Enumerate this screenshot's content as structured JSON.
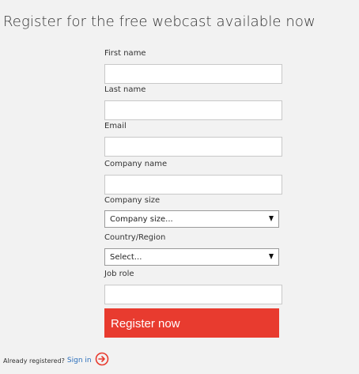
{
  "page": {
    "title": "Register for the free webcast available now"
  },
  "form": {
    "first_name_label": "First name",
    "first_name_value": "",
    "last_name_label": "Last name",
    "last_name_value": "",
    "email_label": "Email",
    "email_value": "",
    "company_name_label": "Company name",
    "company_name_value": "",
    "company_size_label": "Company size",
    "company_size_selected": "Company size...",
    "country_label": "Country/Region",
    "country_selected": "Select...",
    "job_role_label": "Job role",
    "job_role_value": "",
    "register_label": "Register now"
  },
  "footer": {
    "already_registered_text": "Already registered?",
    "sign_in_label": "Sign in",
    "arrow_icon": "circle-arrow-right-icon"
  },
  "colors": {
    "background": "#f2f2f2",
    "accent": "#e83b2f",
    "link": "#2a6ebb"
  }
}
